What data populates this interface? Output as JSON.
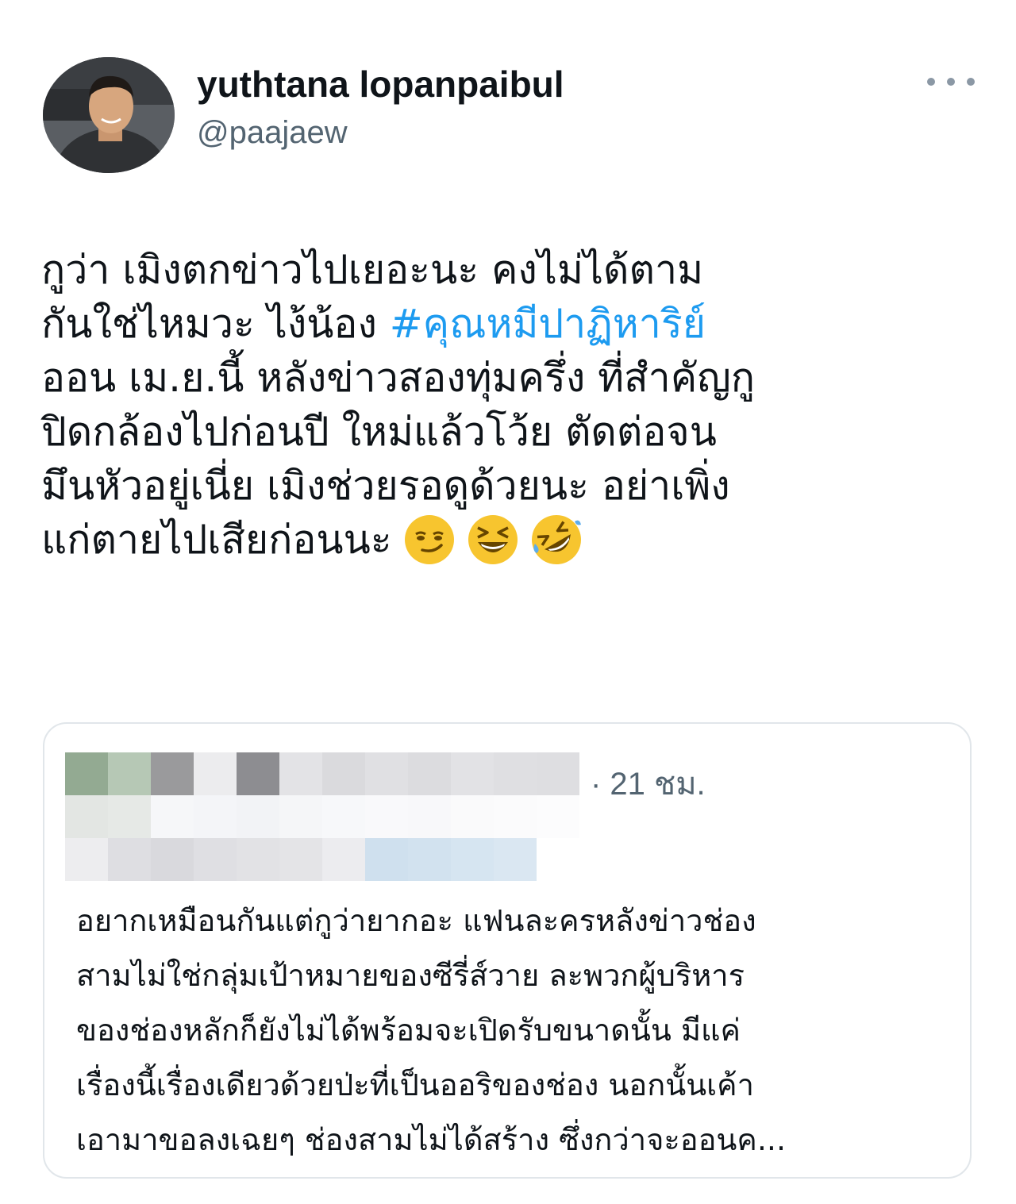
{
  "tweet": {
    "author_name": "yuthtana lopanpaibul",
    "author_handle": "@paajaew",
    "lines": [
      "กูว่า  เมิงตกข่าวไปเยอะนะ  คงไม่ได้ตาม",
      "กันใช่ไหมวะ ไง้น้อง ",
      "ออน เม.ย.นี้  หลังข่าวสองทุ่มครึ่ง ที่สำคัญกู",
      "ปิดกล้องไปก่อนปี ใหม่แล้วโว้ย  ตัดต่อจน",
      "มึนหัวอยู่เนี่ย  เมิงช่วยรอดูด้วยนะ อย่าเพิ่ง",
      "แก่ตายไปเสียก่อนนะ"
    ],
    "hashtag": "#คุณหมีปาฏิหาริย์",
    "emojis": [
      "smirking-face",
      "grinning-squinting-face",
      "rolling-on-floor-laughing"
    ]
  },
  "quote": {
    "time": "· 21 ชม.",
    "lines": [
      "อยากเหมือนกันแต่กูว่ายากอะ แฟนละครหลังข่าวช่อง",
      "สามไม่ใช่กลุ่มเป้าหมายของซีรี่ส์วาย ละพวกผู้บริหาร",
      "ของช่องหลักก็ยังไม่ได้พร้อมจะเปิดรับขนาดนั้น มีแค่",
      "เรื่องนี้เรื่องเดียวด้วยป่ะที่เป็นออริของช่อง นอกนั้นเค้า",
      "เอามาขอลงเฉยๆ ช่องสามไม่ได้สร้าง ซึ่งกว่าจะออนค..."
    ]
  },
  "colors": {
    "hashtag": "#1d9bf0",
    "secondary_text": "#536471",
    "border": "#e1e6ea",
    "emoji_yellow": "#f7c52f"
  }
}
